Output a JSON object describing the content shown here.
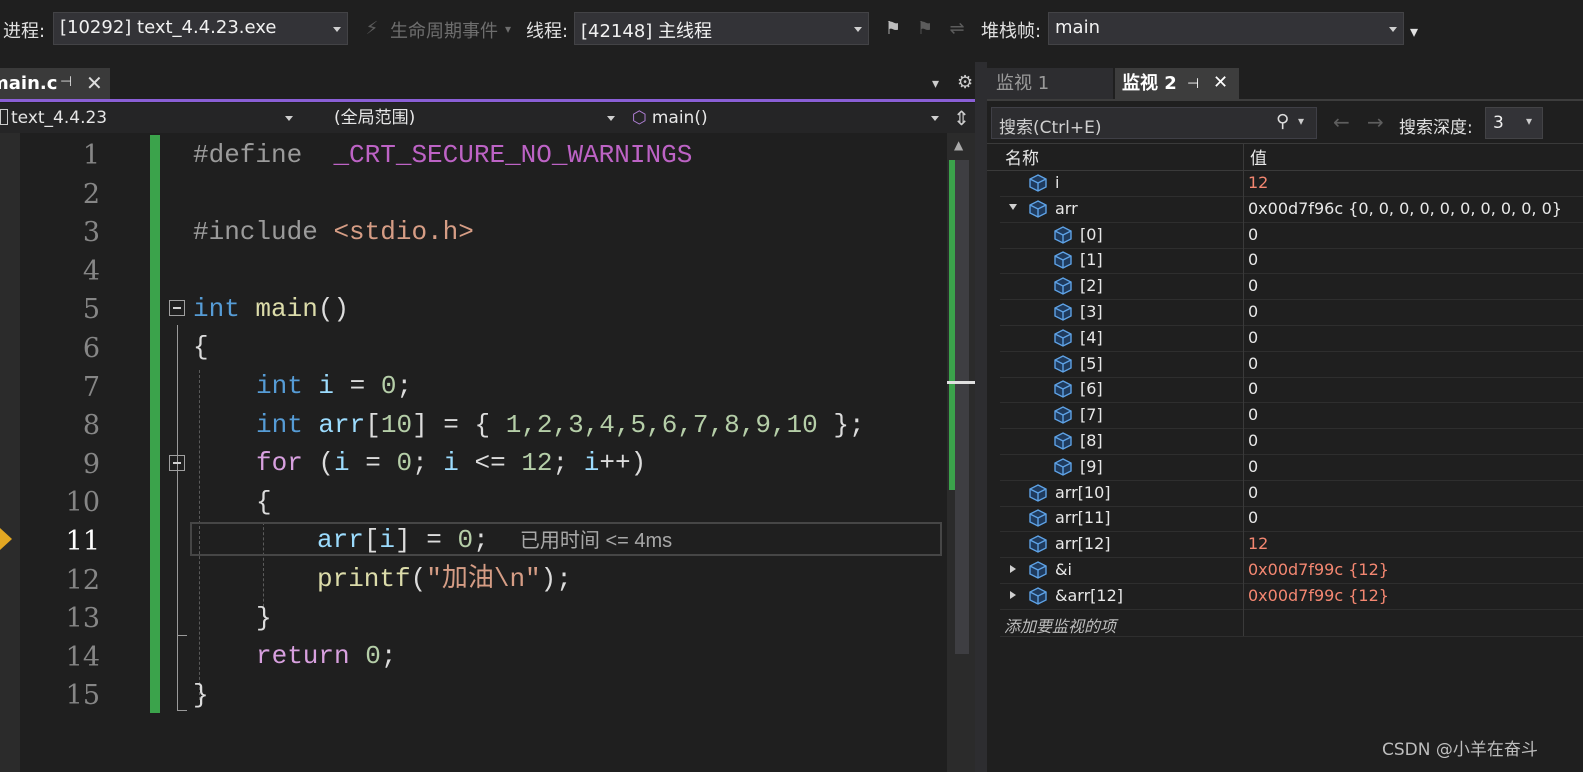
{
  "toolbar": {
    "process_label": "进程:",
    "process_value": "[10292] text_4.4.23.exe",
    "lifecycle_label": "生命周期事件",
    "thread_label": "线程:",
    "thread_value": "[42148] 主线程",
    "stackframe_label": "堆栈帧:",
    "stackframe_value": "main"
  },
  "editor": {
    "tab_label": "main.c",
    "nav_project": "text_4.4.23",
    "nav_scope": "(全局范围)",
    "nav_function": "main()",
    "elapsed": "已用时间 <= 4ms",
    "current_line": "11",
    "line_numbers": [
      "1",
      "2",
      "3",
      "4",
      "5",
      "6",
      "7",
      "8",
      "9",
      "10",
      "11",
      "12",
      "13",
      "14",
      "15"
    ],
    "code": {
      "l1a": "#define",
      "l1b": "_CRT_SECURE_NO_WARNINGS",
      "l3a": "#include",
      "l3b": "<stdio.h>",
      "l5a": "int",
      "l5b": "main",
      "l5c": "()",
      "l6": "{",
      "l7a": "int",
      "l7b": "i",
      "l7c": " = ",
      "l7d": "0",
      "l7e": ";",
      "l8a": "int",
      "l8b": "arr",
      "l8c": "[",
      "l8d": "10",
      "l8e": "] = { ",
      "l8f": "1,2,3,4,5,6,7,8,9,10",
      "l8g": " };",
      "l9a": "for",
      "l9b": " (",
      "l9c": "i",
      "l9d": " = ",
      "l9e": "0",
      "l9f": "; ",
      "l9g": "i",
      "l9h": " <= ",
      "l9i": "12",
      "l9j": "; ",
      "l9k": "i",
      "l9l": "++)",
      "l10": "{",
      "l11a": "arr",
      "l11b": "[",
      "l11c": "i",
      "l11d": "] = ",
      "l11e": "0",
      "l11f": ";",
      "l12a": "printf",
      "l12b": "(",
      "l12c": "\"加油\\n\"",
      "l12d": ");",
      "l13": "}",
      "l14a": "return",
      "l14b": " ",
      "l14c": "0",
      "l14d": ";",
      "l15": "}"
    }
  },
  "watch": {
    "tab1_label": "监视 1",
    "tab2_label": "监视 2",
    "search_placeholder": "搜索(Ctrl+E)",
    "depth_label": "搜索深度:",
    "depth_value": "3",
    "col_name": "名称",
    "col_value": "值",
    "rows": [
      {
        "name": "i",
        "value": "12",
        "changed": true
      },
      {
        "name": "arr",
        "value": "0x00d7f96c {0, 0, 0, 0, 0, 0, 0, 0, 0, 0}",
        "changed": false
      },
      {
        "name": "[0]",
        "value": "0",
        "changed": false
      },
      {
        "name": "[1]",
        "value": "0",
        "changed": false
      },
      {
        "name": "[2]",
        "value": "0",
        "changed": false
      },
      {
        "name": "[3]",
        "value": "0",
        "changed": false
      },
      {
        "name": "[4]",
        "value": "0",
        "changed": false
      },
      {
        "name": "[5]",
        "value": "0",
        "changed": false
      },
      {
        "name": "[6]",
        "value": "0",
        "changed": false
      },
      {
        "name": "[7]",
        "value": "0",
        "changed": false
      },
      {
        "name": "[8]",
        "value": "0",
        "changed": false
      },
      {
        "name": "[9]",
        "value": "0",
        "changed": false
      },
      {
        "name": "arr[10]",
        "value": "0",
        "changed": false
      },
      {
        "name": "arr[11]",
        "value": "0",
        "changed": false
      },
      {
        "name": "arr[12]",
        "value": "12",
        "changed": true
      },
      {
        "name": "&i",
        "value": "0x00d7f99c {12}",
        "changed": true
      },
      {
        "name": "&arr[12]",
        "value": "0x00d7f99c {12}",
        "changed": true
      }
    ],
    "add_item_label": "添加要监视的项"
  },
  "watermark": "CSDN @小羊在奋斗",
  "colors": {
    "accent": "#8a5fd6",
    "changed_value": "#f48771",
    "change_bar": "#3ba34b",
    "instruction_pointer": "#e2a722"
  }
}
